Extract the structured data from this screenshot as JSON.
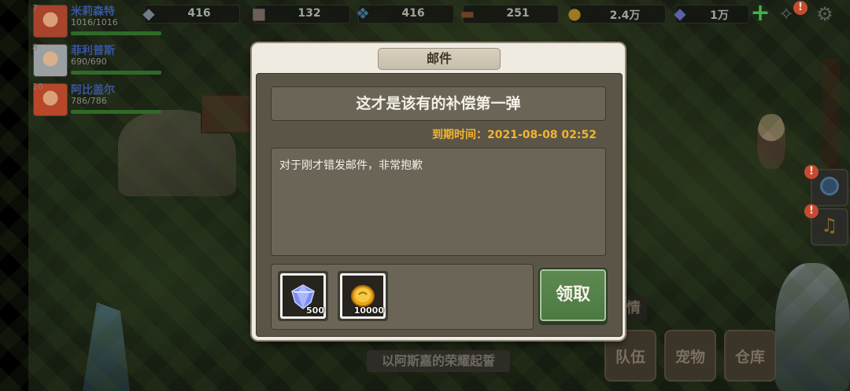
{
  "resources": [
    {
      "icon": "stone-icon",
      "value": "416"
    },
    {
      "icon": "iron-icon",
      "value": "132"
    },
    {
      "icon": "crystal-icon",
      "value": "416"
    },
    {
      "icon": "wood-icon",
      "value": "251"
    },
    {
      "icon": "gold-coin-icon",
      "value": "2.4万"
    },
    {
      "icon": "diamond-icon",
      "value": "1万"
    }
  ],
  "party": [
    {
      "level": "7",
      "name": "米莉森特",
      "hp": "1016/1016",
      "hp_fraction": 1.0
    },
    {
      "level": "8",
      "name": "菲利普斯",
      "hp": "690/690",
      "hp_fraction": 1.0
    },
    {
      "level": "10",
      "name": "阿比盖尔",
      "hp": "786/786",
      "hp_fraction": 1.0
    }
  ],
  "badges": {
    "alert": "!"
  },
  "mail": {
    "title": "邮件",
    "subject": "这才是该有的补偿第一弹",
    "expire_label": "到期时间：",
    "expire_value": "2021-08-08 02:52",
    "body": "对于刚才错发邮件，非常抱歉",
    "attachments": [
      {
        "icon": "diamond-icon",
        "count": "500"
      },
      {
        "icon": "gold-coin-icon",
        "count": "10000"
      }
    ],
    "claim_label": "领取"
  },
  "bottom_menu": {
    "team": "队伍",
    "pets": "宠物",
    "warehouse": "仓库"
  },
  "chat_tab": "情",
  "status_text": "以阿斯嘉的荣耀起誓",
  "colors": {
    "expire": "#f1b52e",
    "claim_button": "#5e8a52",
    "dialog_frame": "#f0ebe0"
  }
}
